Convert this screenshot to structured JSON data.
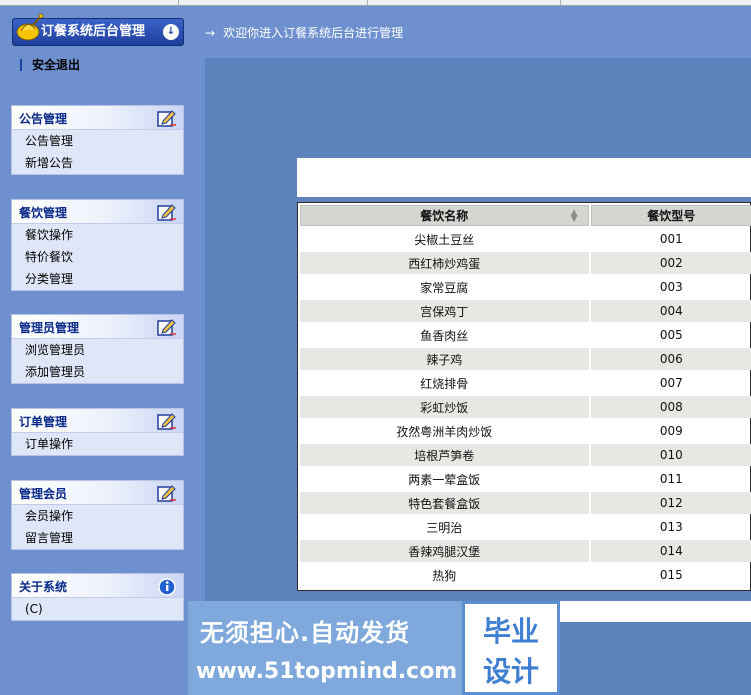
{
  "app": {
    "title": "订餐系统后台管理",
    "logout": "安全退出",
    "welcome": "欢迎你进入订餐系统后台进行管理"
  },
  "sidebar": {
    "panels": [
      {
        "title": "公告管理",
        "icon": "edit-icon",
        "items": [
          "公告管理",
          "新增公告"
        ]
      },
      {
        "title": "餐饮管理",
        "icon": "edit-icon",
        "items": [
          "餐饮操作",
          "特价餐饮",
          "分类管理"
        ]
      },
      {
        "title": "管理员管理",
        "icon": "edit-icon",
        "items": [
          "浏览管理员",
          "添加管理员"
        ]
      },
      {
        "title": "订单管理",
        "icon": "edit-icon",
        "items": [
          "订单操作"
        ]
      },
      {
        "title": "管理会员",
        "icon": "edit-icon",
        "items": [
          "会员操作",
          "留言管理"
        ]
      },
      {
        "title": "关于系统",
        "icon": "info-icon",
        "items": [
          "(C)"
        ]
      }
    ]
  },
  "grid": {
    "columns": [
      "餐饮名称",
      "餐饮型号"
    ],
    "rows": [
      [
        "尖椒土豆丝",
        "001"
      ],
      [
        "西红柿炒鸡蛋",
        "002"
      ],
      [
        "家常豆腐",
        "003"
      ],
      [
        "宫保鸡丁",
        "004"
      ],
      [
        "鱼香肉丝",
        "005"
      ],
      [
        "辣子鸡",
        "006"
      ],
      [
        "红烧排骨",
        "007"
      ],
      [
        "彩虹炒饭",
        "008"
      ],
      [
        "孜然粤洲羊肉炒饭",
        "009"
      ],
      [
        "培根芦笋卷",
        "010"
      ],
      [
        "两素一荤盒饭",
        "011"
      ],
      [
        "特色套餐盒饭",
        "012"
      ],
      [
        "三明治",
        "013"
      ],
      [
        "香辣鸡腿汉堡",
        "014"
      ],
      [
        "热狗",
        "015"
      ]
    ]
  },
  "watermark": {
    "line1": "无须担心.自动发货",
    "line2": "www.51topmind.com",
    "badge1": "毕业",
    "badge2": "设计"
  },
  "colors": {
    "background": "#6e90cf",
    "main": "#5d83bd",
    "title_bar": "#1f3f9e",
    "panel_title": "#0a2a8a",
    "row_alt": "#e6e8e4"
  }
}
